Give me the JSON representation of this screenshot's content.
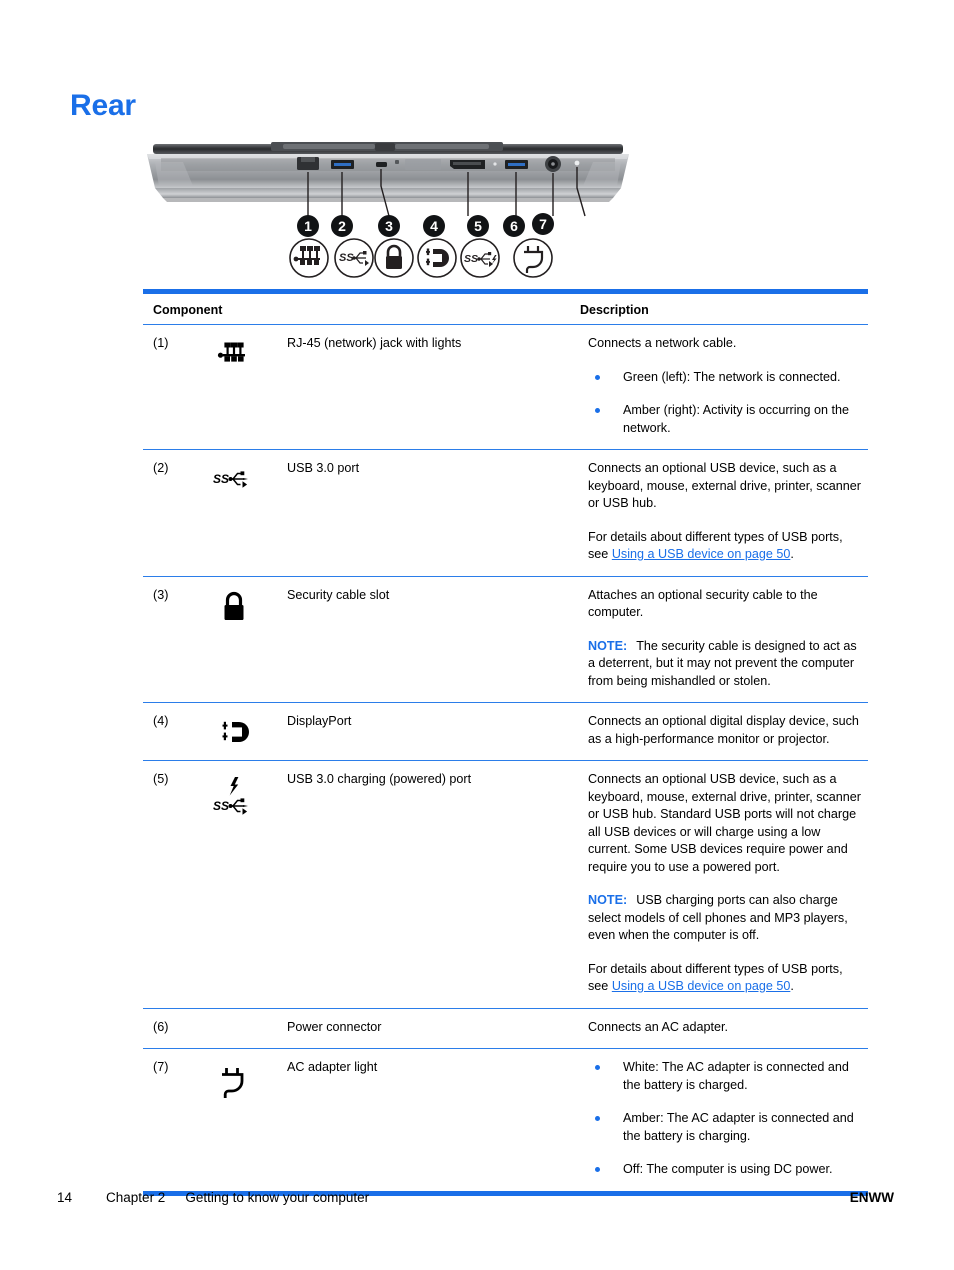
{
  "heading": "Rear",
  "illustration": {
    "alt": "Rear view of laptop showing seven numbered ports",
    "callouts": [
      "1",
      "2",
      "3",
      "4",
      "5",
      "6",
      "7"
    ],
    "callout_icons": [
      "rj45-network-icon",
      "usb-superspeed-icon",
      "lock-icon",
      "displayport-icon",
      "usb-superspeed-charging-icon",
      "",
      "power-plug-icon"
    ]
  },
  "table": {
    "header": {
      "component": "Component",
      "description": "Description"
    },
    "rows": [
      {
        "num": "(1)",
        "icon": "rj45-network-icon",
        "name": "RJ-45 (network) jack with lights",
        "desc_intro": "Connects a network cable.",
        "bullets": [
          "Green (left): The network is connected.",
          "Amber (right): Activity is occurring on the network."
        ]
      },
      {
        "num": "(2)",
        "icon": "usb-superspeed-icon",
        "name": "USB 3.0 port",
        "desc_p1": "Connects an optional USB device, such as a keyboard, mouse, external drive, printer, scanner or USB hub.",
        "desc_p2_pre": "For details about different types of USB ports, see ",
        "desc_p2_link": "Using a USB device on page 50",
        "desc_p2_post": "."
      },
      {
        "num": "(3)",
        "icon": "lock-icon",
        "name": "Security cable slot",
        "desc_p1": "Attaches an optional security cable to the computer.",
        "note_label": "NOTE:",
        "note_text": "The security cable is designed to act as a deterrent, but it may not prevent the computer from being mishandled or stolen."
      },
      {
        "num": "(4)",
        "icon": "displayport-icon",
        "name": "DisplayPort",
        "desc_p1": "Connects an optional digital display device, such as a high-performance monitor or projector."
      },
      {
        "num": "(5)",
        "icon": "usb-superspeed-charging-icon",
        "name": "USB 3.0 charging (powered) port",
        "desc_p1": "Connects an optional USB device, such as a keyboard, mouse, external drive, printer, scanner or USB hub. Standard USB ports will not charge all USB devices or will charge using a low current. Some USB devices require power and require you to use a powered port.",
        "note_label": "NOTE:",
        "note_text": "USB charging ports can also charge select models of cell phones and MP3 players, even when the computer is off.",
        "desc_p3_pre": "For details about different types of USB ports, see ",
        "desc_p3_link": "Using a USB device on page 50",
        "desc_p3_post": "."
      },
      {
        "num": "(6)",
        "icon": "",
        "name": "Power connector",
        "desc_p1": "Connects an AC adapter."
      },
      {
        "num": "(7)",
        "icon": "power-plug-icon",
        "name": "AC adapter light",
        "bullets": [
          "White: The AC adapter is connected and the battery is charged.",
          "Amber: The AC adapter is connected and the battery is charging.",
          "Off: The computer is using DC power."
        ]
      }
    ]
  },
  "footer": {
    "page_number": "14",
    "chapter": "Chapter 2",
    "chapter_title": "Getting to know your computer",
    "locale": "ENWW"
  },
  "colors": {
    "accent_blue": "#1a6fe8",
    "rule_blue": "#2b7de9",
    "text": "#000000"
  }
}
